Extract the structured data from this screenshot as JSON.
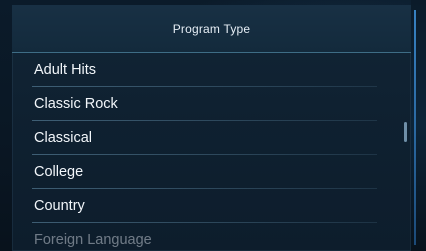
{
  "header": {
    "title": "Program Type"
  },
  "program_types": [
    {
      "label": "Adult Hits"
    },
    {
      "label": "Classic Rock"
    },
    {
      "label": "Classical"
    },
    {
      "label": "College"
    },
    {
      "label": "Country"
    },
    {
      "label": "Foreign Language"
    }
  ],
  "colors": {
    "panel_bg": "#0f2131",
    "header_divider": "#5fa0be",
    "text": "#f2f6fa"
  }
}
